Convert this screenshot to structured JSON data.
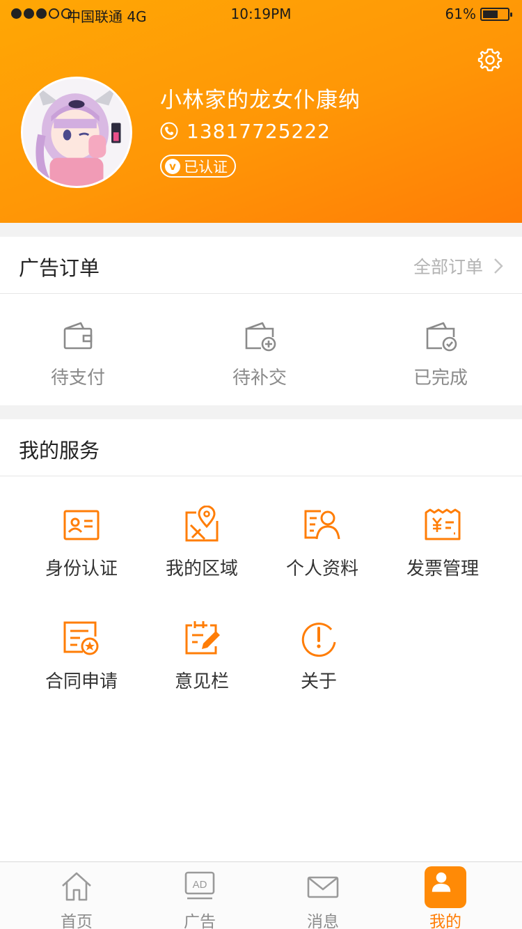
{
  "status_bar": {
    "carrier": "中国联通",
    "network": "4G",
    "time": "10:19PM",
    "battery_percent": "61%",
    "battery_level": 0.61,
    "signal_bars_filled": 3,
    "signal_bars_total": 5
  },
  "profile": {
    "name": "小林家的龙女仆康纳",
    "phone": "13817725222",
    "verified_label": "已认证",
    "verified_icon_letter": "v",
    "settings_icon": "gear-icon"
  },
  "orders": {
    "title": "广告订单",
    "all_link": "全部订单",
    "items": [
      {
        "label": "待支付",
        "icon": "wallet-icon"
      },
      {
        "label": "待补交",
        "icon": "wallet-plus-icon"
      },
      {
        "label": "已完成",
        "icon": "wallet-check-icon"
      }
    ]
  },
  "services": {
    "title": "我的服务",
    "items": [
      {
        "label": "身份认证",
        "icon": "id-card-icon"
      },
      {
        "label": "我的区域",
        "icon": "map-pin-icon"
      },
      {
        "label": "个人资料",
        "icon": "profile-icon"
      },
      {
        "label": "发票管理",
        "icon": "invoice-icon"
      },
      {
        "label": "合同申请",
        "icon": "contract-icon"
      },
      {
        "label": "意见栏",
        "icon": "feedback-icon"
      },
      {
        "label": "关于",
        "icon": "about-icon"
      }
    ]
  },
  "tabbar": {
    "items": [
      {
        "label": "首页",
        "icon": "home-icon"
      },
      {
        "label": "广告",
        "icon": "ad-icon",
        "icon_text": "AD"
      },
      {
        "label": "消息",
        "icon": "mail-icon"
      },
      {
        "label": "我的",
        "icon": "user-icon",
        "active": true
      }
    ]
  },
  "colors": {
    "accent": "#ff8a06",
    "header_gradient_start": "#ffa705",
    "header_gradient_end": "#ff7d06",
    "inactive_text": "#8c8c8c"
  }
}
